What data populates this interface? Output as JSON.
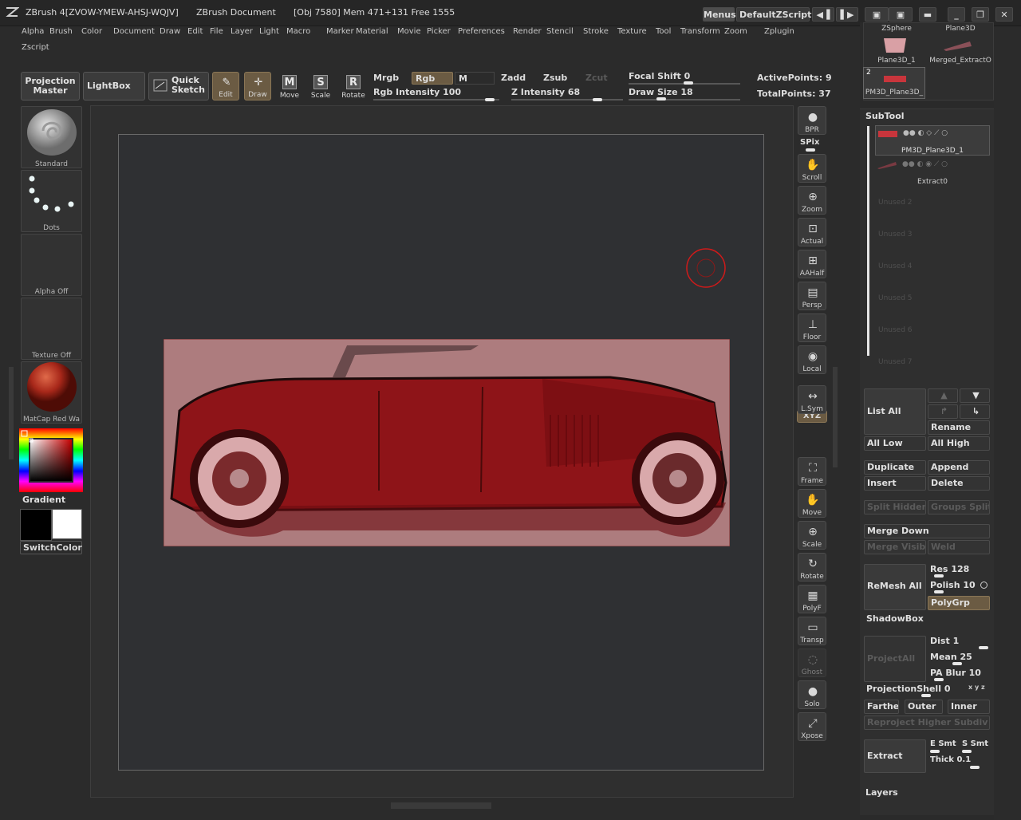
{
  "titlebar": {
    "app_title": "ZBrush 4[ZVOW-YMEW-AHSJ-WQJV]",
    "doc_title": "ZBrush Document",
    "stats": "[Obj 7580]  Mem 471+131  Free 1555",
    "menus_label": "Menus",
    "script_label": "DefaultZScript"
  },
  "menubar": {
    "items": [
      "Alpha",
      "Brush",
      "Color",
      "Document",
      "Draw",
      "Edit",
      "File",
      "Layer",
      "Light",
      "Macro",
      "Marker",
      "Material",
      "Movie",
      "Picker",
      "Preferences",
      "Render",
      "Stencil",
      "Stroke",
      "Texture",
      "Tool",
      "Transform",
      "Zoom",
      "Zplugin"
    ],
    "second_row": [
      "Zscript"
    ]
  },
  "shelf": {
    "projection_master": "Projection Master",
    "lightbox": "LightBox",
    "quick_sketch": "Quick Sketch",
    "tools": [
      {
        "label": "Edit",
        "icon": "edit-icon"
      },
      {
        "label": "Draw",
        "icon": "draw-icon"
      },
      {
        "label": "Move",
        "icon": "move-icon"
      },
      {
        "label": "Scale",
        "icon": "scale-icon"
      },
      {
        "label": "Rotate",
        "icon": "rotate-icon"
      }
    ],
    "mrgb": "Mrgb",
    "rgb": "Rgb",
    "m": "M",
    "zadd": "Zadd",
    "zsub": "Zsub",
    "zcut": "Zcut",
    "rgb_intensity_label": "Rgb Intensity",
    "rgb_intensity": "100",
    "z_intensity_label": "Z Intensity",
    "z_intensity": "68",
    "focal_shift_label": "Focal Shift",
    "focal_shift": "0",
    "draw_size_label": "Draw Size",
    "draw_size": "18",
    "active_points": "ActivePoints: 9",
    "total_points": "TotalPoints: 37"
  },
  "leftcol": {
    "brush_label": "Standard",
    "stroke_label": "Dots",
    "alpha_label": "Alpha Off",
    "texture_label": "Texture Off",
    "material_label": "MatCap Red Wa",
    "gradient_label": "Gradient",
    "switchcolor_label": "SwitchColor",
    "colors": {
      "main": "#000000",
      "secondary": "#ffffff"
    }
  },
  "righttools": [
    {
      "label": "BPR",
      "icon": "bpr-sphere-icon"
    },
    {
      "label": "Scroll",
      "icon": "scroll-hand-icon"
    },
    {
      "label": "Zoom",
      "icon": "zoom-icon"
    },
    {
      "label": "Actual",
      "icon": "actual-icon"
    },
    {
      "label": "AAHalf",
      "icon": "aahalf-icon"
    },
    {
      "label": "Persp",
      "icon": "persp-icon"
    },
    {
      "label": "Floor",
      "icon": "floor-icon"
    },
    {
      "label": "Local",
      "icon": "local-icon"
    },
    {
      "label": "L.Sym",
      "icon": "lsym-icon"
    },
    {
      "label": "Frame",
      "icon": "frame-icon"
    },
    {
      "label": "Move",
      "icon": "move-hand-icon"
    },
    {
      "label": "Scale",
      "icon": "scale-icon"
    },
    {
      "label": "Rotate",
      "icon": "rotate-icon"
    },
    {
      "label": "PolyF",
      "icon": "polyf-icon"
    },
    {
      "label": "Transp",
      "icon": "transp-icon"
    },
    {
      "label": "Ghost",
      "icon": "ghost-icon"
    },
    {
      "label": "Solo",
      "icon": "solo-icon"
    },
    {
      "label": "Xpose",
      "icon": "xpose-icon"
    }
  ],
  "spix_label": "SPix",
  "xyz_label": "XYZ",
  "toolpanel": {
    "thumbs": [
      "ZSphere",
      "Plane3D",
      "Plane3D_1",
      "Merged_ExtractO",
      "PM3D_Plane3D_"
    ],
    "thumb_count": "2",
    "subtool_title": "SubTool",
    "subtools": [
      "PM3D_Plane3D_1",
      "Extract0"
    ],
    "unused": [
      "Unused 2",
      "Unused 3",
      "Unused 4",
      "Unused 5",
      "Unused 6",
      "Unused 7"
    ],
    "list_all": "List All",
    "rename": "Rename",
    "all_low": "All Low",
    "all_high": "All High",
    "duplicate": "Duplicate",
    "append": "Append",
    "insert": "Insert",
    "delete": "Delete",
    "split_hidden": "Split Hidden",
    "groups_split": "Groups Split",
    "merge_down": "Merge Down",
    "merge_visible": "Merge Visible",
    "weld": "Weld",
    "remesh_all": "ReMesh All",
    "res_label": "Res",
    "res": "128",
    "polish_label": "Polish",
    "polish": "10",
    "polygrp": "PolyGrp",
    "shadowbox": "ShadowBox",
    "projectall": "ProjectAll",
    "dist_label": "Dist",
    "dist": "1",
    "mean_label": "Mean",
    "mean": "25",
    "pablur_label": "PA Blur",
    "pablur": "10",
    "projectionshell_label": "ProjectionShell",
    "projectionshell": "0",
    "xyz_small": "x y z",
    "farthest": "Farthest",
    "outer": "Outer",
    "inner": "Inner",
    "reproject": "Reproject Higher Subdiv",
    "extract": "Extract",
    "esmt": "E Smt",
    "ssmt": "S Smt",
    "thick_label": "Thick",
    "thick": "0.1",
    "layers": "Layers"
  }
}
